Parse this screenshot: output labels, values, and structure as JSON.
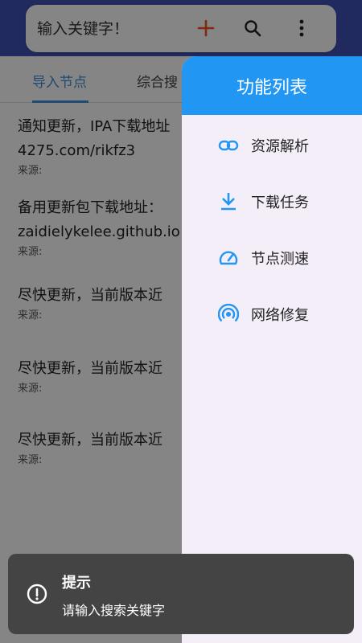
{
  "search": {
    "placeholder": "输入关键字！"
  },
  "toolbar": {
    "add_icon": "plus-icon",
    "search_icon": "search-icon",
    "more_icon": "more-vert-icon",
    "accent": "#f4511e"
  },
  "tabs": [
    {
      "label": "导入节点"
    },
    {
      "label": "综合搜"
    }
  ],
  "list": [
    {
      "title": "通知更新，IPA下载地址",
      "title2": "4275.com/rikfz3",
      "source": "来源:"
    },
    {
      "title": "备用更新包下载地址：",
      "title2": "zaidielykelee.github.io",
      "source": "来源:"
    },
    {
      "title": "尽快更新，当前版本近",
      "source": "来源:"
    },
    {
      "title": "尽快更新，当前版本近",
      "source": "来源:"
    },
    {
      "title": "尽快更新，当前版本近",
      "source": "来源:"
    }
  ],
  "drawer": {
    "title": "功能列表",
    "items": [
      {
        "label": "资源解析",
        "icon": "link-icon"
      },
      {
        "label": "下载任务",
        "icon": "download-icon"
      },
      {
        "label": "节点测速",
        "icon": "speedometer-icon"
      },
      {
        "label": "网络修复",
        "icon": "wifi-signal-icon"
      }
    ],
    "header_color": "#2196f3",
    "icon_color": "#2196f3"
  },
  "toast": {
    "title": "提示",
    "message": "请输入搜索关键字"
  }
}
